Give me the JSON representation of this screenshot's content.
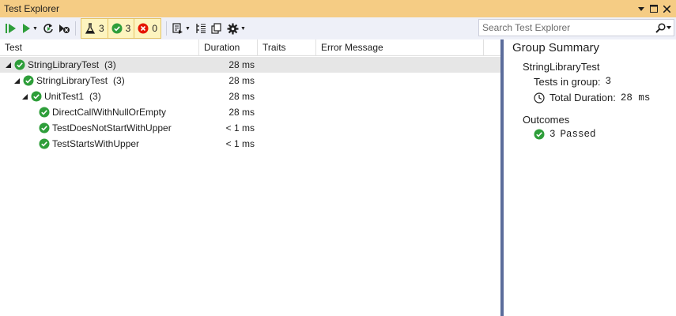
{
  "window": {
    "title": "Test Explorer"
  },
  "toolbar": {
    "filter_total_count": "3",
    "filter_passed_count": "3",
    "filter_failed_count": "0"
  },
  "search": {
    "placeholder": "Search Test Explorer"
  },
  "columns": {
    "test": "Test",
    "duration": "Duration",
    "traits": "Traits",
    "error_message": "Error Message"
  },
  "tree": [
    {
      "name": "StringLibraryTest",
      "count": "(3)",
      "duration": "28 ms"
    },
    {
      "name": "StringLibraryTest",
      "count": "(3)",
      "duration": "28 ms"
    },
    {
      "name": "UnitTest1",
      "count": "(3)",
      "duration": "28 ms"
    },
    {
      "name": "DirectCallWithNullOrEmpty",
      "count": "",
      "duration": "28 ms"
    },
    {
      "name": "TestDoesNotStartWithUpper",
      "count": "",
      "duration": "< 1 ms"
    },
    {
      "name": "TestStartsWithUpper",
      "count": "",
      "duration": "< 1 ms"
    }
  ],
  "summary": {
    "title": "Group Summary",
    "group_name": "StringLibraryTest",
    "tests_in_group_label": "Tests in group:",
    "tests_in_group_value": "3",
    "total_duration_label": "Total Duration:",
    "total_duration_value": "28 ms",
    "outcomes_label": "Outcomes",
    "passed_count": "3",
    "passed_label": "Passed"
  },
  "colors": {
    "titlebar": "#f5cc84",
    "toolbar": "#eef0f8",
    "pass_green": "#2e9e3a",
    "fail_red": "#e51400",
    "splitter": "#5b6c9b",
    "selected_row": "#e6e6e6"
  },
  "icons": {
    "run_all": "run-all-icon",
    "run": "play-icon",
    "repeat": "repeat-icon",
    "cancel": "cancel-icon",
    "flask": "flask-icon",
    "pass": "check-circle-icon",
    "fail": "x-circle-icon",
    "playlist": "playlist-icon",
    "hierarchy": "hierarchy-icon",
    "copy": "copy-icon",
    "settings": "gear-icon",
    "search": "search-icon",
    "clock": "clock-icon"
  }
}
